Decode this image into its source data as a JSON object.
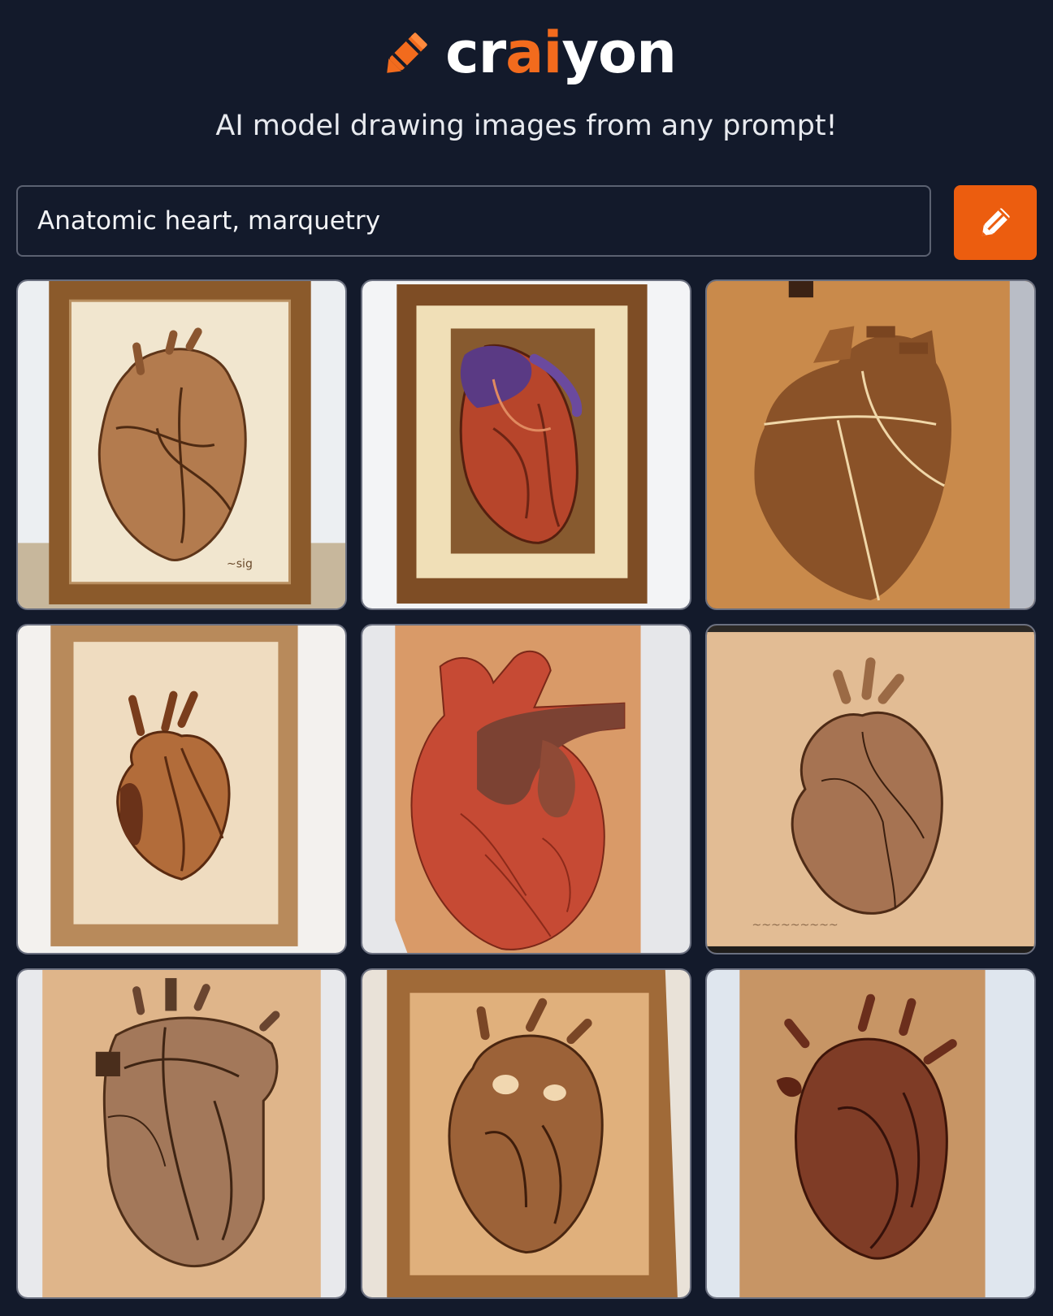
{
  "header": {
    "logo_part1": "cr",
    "logo_accent": "ai",
    "logo_part2": "yon",
    "tagline": "AI model drawing images from any prompt!"
  },
  "search": {
    "prompt_value": "Anatomic heart, marquetry",
    "button_icon": "pencil-icon"
  },
  "colors": {
    "background": "#131a2b",
    "accent": "#ec5d0f",
    "logo_accent": "#f26b1d"
  },
  "results": [
    {
      "subject": "framed marquetry anatomic heart"
    },
    {
      "subject": "framed marquetry anatomic heart in red and purple"
    },
    {
      "subject": "marquetry heart inlay on light wood board"
    },
    {
      "subject": "framed marquetry heart with dark veins"
    },
    {
      "subject": "red marquetry heart on wood panel"
    },
    {
      "subject": "carved heart on beech wood panel"
    },
    {
      "subject": "engraved anatomic heart on oak panel"
    },
    {
      "subject": "carved anatomic heart in wooden frame"
    },
    {
      "subject": "dark stained heart inlay on wood board"
    }
  ]
}
